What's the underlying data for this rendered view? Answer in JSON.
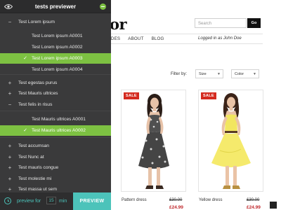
{
  "shop": {
    "logo_fragment": "or",
    "search_placeholder": "Search",
    "go_label": "Go",
    "nav": [
      "IDES",
      "ABOUT",
      "BLOG"
    ],
    "logged_in": "Logged in as John Doe",
    "filter_label": "Filter by:",
    "filter_size": "Size",
    "filter_color": "Color",
    "products": [
      {
        "badge": "SALE",
        "name": "Pattern dress",
        "old_price": "£30.00",
        "new_price": "£24.99"
      },
      {
        "badge": "SALE",
        "name": "Yellow dress",
        "old_price": "£30.00",
        "new_price": "£24.99"
      }
    ]
  },
  "previewer": {
    "title": "tests previewer",
    "tree": [
      {
        "label": "Test Lorem ipsum",
        "symbol": "−",
        "level": 0,
        "active": false
      },
      {
        "label": "Test Lorem ipsum A0001",
        "symbol": "",
        "level": 1,
        "active": false
      },
      {
        "label": "Test Lorem ipsum A0002",
        "symbol": "",
        "level": 1,
        "active": false
      },
      {
        "label": "Test Lorem ipsum A0003",
        "symbol": "✓",
        "level": 1,
        "active": true
      },
      {
        "label": "Test Lorem ipsum A0004",
        "symbol": "",
        "level": 1,
        "active": false
      },
      {
        "label": "Test egestas purus",
        "symbol": "+",
        "level": 0,
        "active": false
      },
      {
        "label": "Test Mauris ultrices",
        "symbol": "+",
        "level": 0,
        "active": false
      },
      {
        "label": "Test felis in risus",
        "symbol": "−",
        "level": 0,
        "active": false
      },
      {
        "label": "Test Mauris ultrices A0001",
        "symbol": "",
        "level": 1,
        "active": false
      },
      {
        "label": "Test Mauris ultrices A0002",
        "symbol": "✓",
        "level": 1,
        "active": true
      },
      {
        "label": "Test accumsan",
        "symbol": "+",
        "level": 0,
        "active": false
      },
      {
        "label": "Test Nunc at",
        "symbol": "+",
        "level": 0,
        "active": false
      },
      {
        "label": "Test mauris congue",
        "symbol": "+",
        "level": 0,
        "active": false
      },
      {
        "label": "Test molestie mi",
        "symbol": "+",
        "level": 0,
        "active": false
      },
      {
        "label": "Test massa ut sem",
        "symbol": "+",
        "level": 0,
        "active": false
      }
    ],
    "footer": {
      "preview_for": "preview for",
      "minutes": "15",
      "min_label": "min",
      "button": "PREVIEW"
    }
  },
  "colors": {
    "accent_green": "#7dc142",
    "accent_teal": "#4cc3ba",
    "sidebar_bg": "#3a3a3b",
    "sale_red": "#d42a1f",
    "price_red": "#c0282c"
  }
}
